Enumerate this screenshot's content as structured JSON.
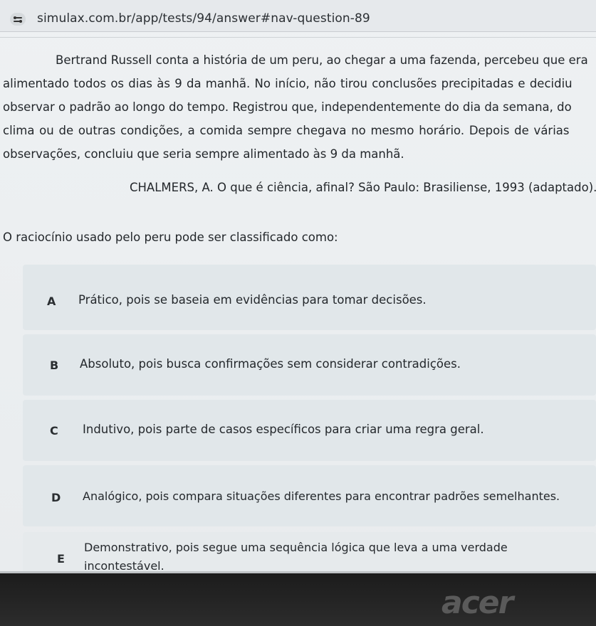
{
  "browser": {
    "url": "simulax.com.br/app/tests/94/answer#nav-question-89",
    "site_icon": "tune-settings-icon"
  },
  "passage": {
    "lines": [
      "Bertrand Russell conta a história de um peru, ao chegar a uma fazenda, percebeu que era",
      "alimentado todos os dias às 9 da manhã. No início, não tirou conclusões precipitadas e decidiu",
      "observar o padrão ao longo do tempo. Registrou que, independentemente do dia da semana, do",
      "clima ou de outras condições, a comida sempre chegava no mesmo horário. Depois de várias",
      "observações, concluiu que seria sempre alimentado às 9 da manhã."
    ]
  },
  "citation": "CHALMERS, A. O que é ciência, afinal? São Paulo: Brasiliense, 1993 (adaptado).",
  "question": "O raciocínio usado pelo peru pode ser classificado como:",
  "options": [
    {
      "letter": "A",
      "text": "Prático, pois se baseia em evidências para tomar decisões."
    },
    {
      "letter": "B",
      "text": "Absoluto, pois busca confirmações sem considerar contradições."
    },
    {
      "letter": "C",
      "text": "Indutivo, pois parte de casos específicos para criar uma regra geral."
    },
    {
      "letter": "D",
      "text": "Analógico, pois compara situações diferentes para encontrar padrões semelhantes."
    },
    {
      "letter": "E",
      "text_line1": "Demonstrativo, pois segue uma sequência lógica que leva a uma verdade",
      "text_line2": "incontestável."
    }
  ],
  "device_brand": "acer"
}
